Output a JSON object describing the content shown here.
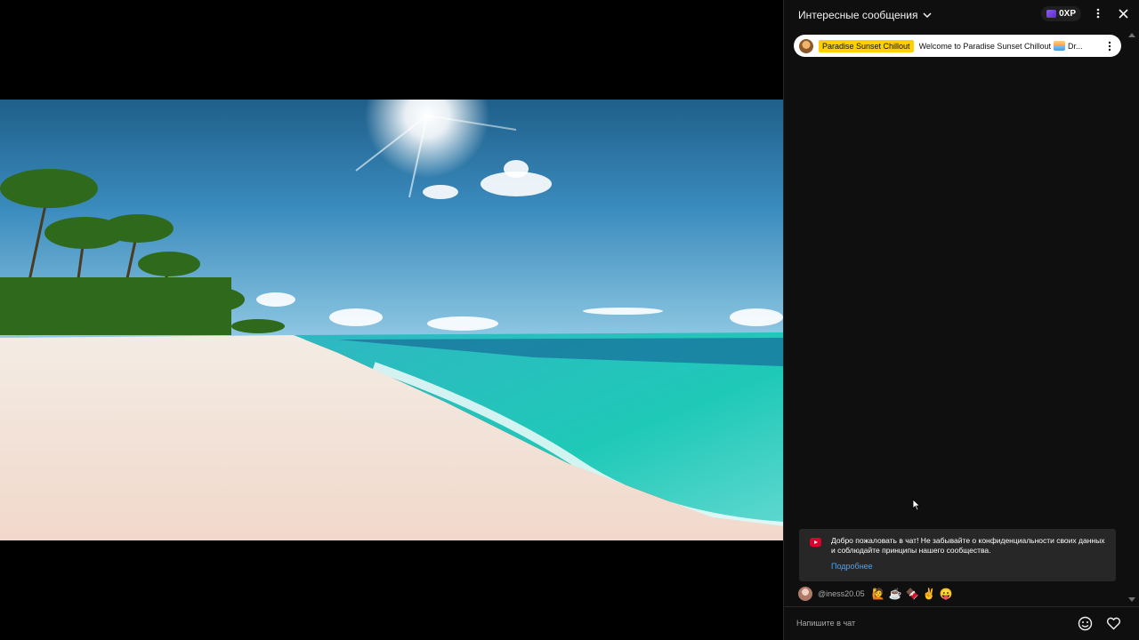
{
  "video": {
    "scene_alt": "tropical beach scene"
  },
  "chat": {
    "title": "Интересные сообщения",
    "xp_label": "0XP",
    "pinned": {
      "author": "Paradise Sunset Chillout",
      "message_start": "Welcome to Paradise Sunset Chillout",
      "message_end": "Dr..."
    },
    "welcome": {
      "text": "Добро пожаловать в чат! Не забывайте о конфиденциальности своих данных и соблюдайте принципы нашего сообщества.",
      "link": "Подробнее"
    },
    "message": {
      "author": "@iness20.05",
      "emojis": [
        "🙋",
        "☕",
        "🍫",
        "✌",
        "😛"
      ]
    },
    "input": {
      "placeholder": "Напишите в чат"
    }
  },
  "colors": {
    "chat_bg": "#0f0f0f",
    "pinned_highlight": "#ffd000",
    "link": "#3ea6ff",
    "youtube_red": "#e1002d"
  }
}
